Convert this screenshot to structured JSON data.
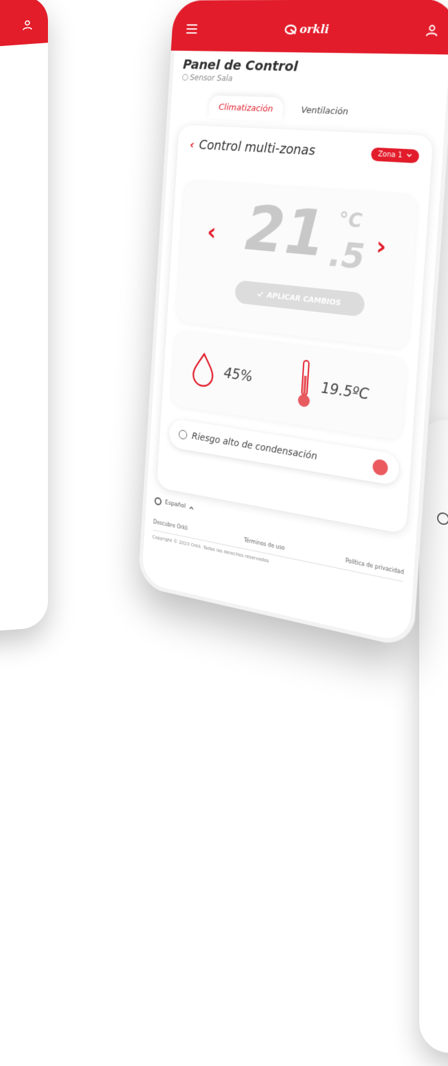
{
  "app": {
    "logo_text": "orkli",
    "brand_color": "#e21c2a"
  },
  "header": {
    "menu_icon": "menu-icon",
    "user_icon": "user-icon"
  },
  "page": {
    "title": "Panel de Control",
    "sensor_label": "Sensor Sala"
  },
  "tabs": [
    {
      "label": "Climatización",
      "active": true
    },
    {
      "label": "Ventilación",
      "active": false
    }
  ],
  "zone_control": {
    "title": "Control multi-zonas",
    "zone_selected": "Zona 1"
  },
  "temperature": {
    "integer": "21",
    "decimal": ".5",
    "unit": "°C",
    "apply_label": "APLICAR CAMBIOS"
  },
  "stats": {
    "humidity": "45%",
    "temperature": "19.5ºC"
  },
  "alert": {
    "text": "Riesgo alto de condensación",
    "status_color": "#ea5a5f"
  },
  "footer": {
    "language": "Español",
    "links": [
      "Descubre Orkli",
      "Términos de uso",
      "Política de privacidad"
    ],
    "copyright": "Copyright © 2023 Orkli. Todos los derechos reservados"
  }
}
